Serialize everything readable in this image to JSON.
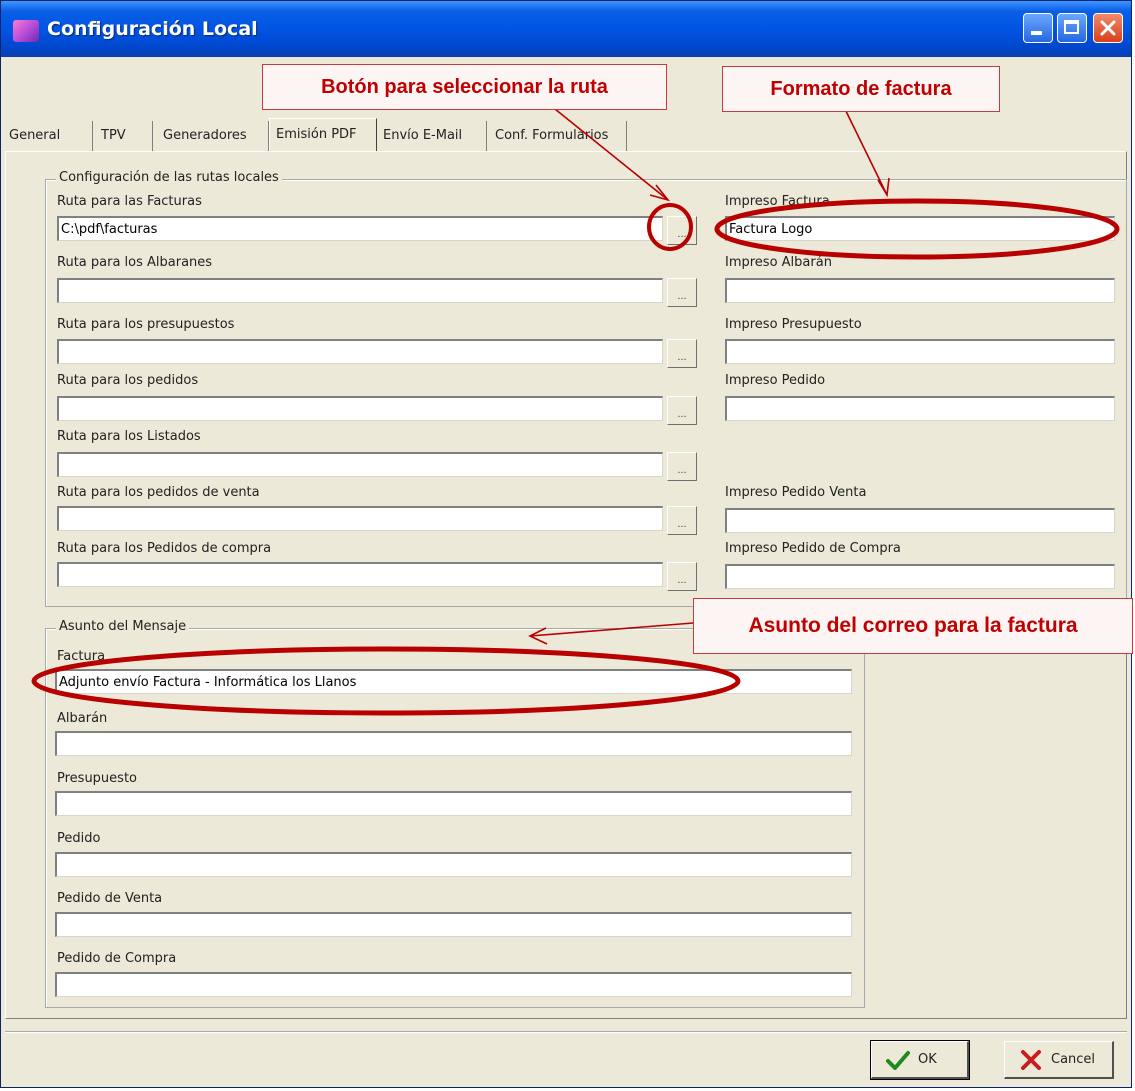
{
  "window": {
    "title": "Configuración Local"
  },
  "tabs": [
    {
      "label": "General",
      "active": false
    },
    {
      "label": "TPV",
      "active": false
    },
    {
      "label": "Generadores",
      "active": false
    },
    {
      "label": "Emisión PDF",
      "active": true
    },
    {
      "label": "Envío E-Mail",
      "active": false
    },
    {
      "label": "Conf. Formularios",
      "active": false
    }
  ],
  "rutas": {
    "group_title": "Configuración de las rutas locales",
    "fields": [
      {
        "label": "Ruta para las Facturas",
        "value": "C:\\pdf\\facturas"
      },
      {
        "label": "Ruta para los Albaranes",
        "value": ""
      },
      {
        "label": "Ruta para los presupuestos",
        "value": ""
      },
      {
        "label": "Ruta para los pedidos",
        "value": ""
      },
      {
        "label": "Ruta para los Listados",
        "value": ""
      },
      {
        "label": "Ruta para los pedidos de venta",
        "value": ""
      },
      {
        "label": "Ruta para los Pedidos de compra",
        "value": ""
      }
    ],
    "browse_label": "...",
    "impresos": [
      {
        "label": "Impreso Factura",
        "value": "Factura Logo"
      },
      {
        "label": "Impreso Albarán",
        "value": ""
      },
      {
        "label": "Impreso Presupuesto",
        "value": ""
      },
      {
        "label": "Impreso Pedido",
        "value": ""
      },
      {
        "label": "Impreso Pedido Venta",
        "value": ""
      },
      {
        "label": "Impreso Pedido de Compra",
        "value": ""
      }
    ]
  },
  "asunto": {
    "group_title": "Asunto del Mensaje",
    "fields": [
      {
        "label": "Factura",
        "value": "Adjunto envío Factura - Informática los Llanos"
      },
      {
        "label": "Albarán",
        "value": ""
      },
      {
        "label": "Presupuesto",
        "value": ""
      },
      {
        "label": "Pedido",
        "value": ""
      },
      {
        "label": "Pedido de Venta",
        "value": ""
      },
      {
        "label": "Pedido de Compra",
        "value": ""
      }
    ]
  },
  "buttons": {
    "ok_label": "OK",
    "cancel_label": "Cancel"
  },
  "annotations": {
    "browse_button": "Botón para seleccionar la ruta",
    "invoice_format": "Formato de factura",
    "invoice_subject": "Asunto del correo para la factura",
    "color": "#c00000"
  }
}
